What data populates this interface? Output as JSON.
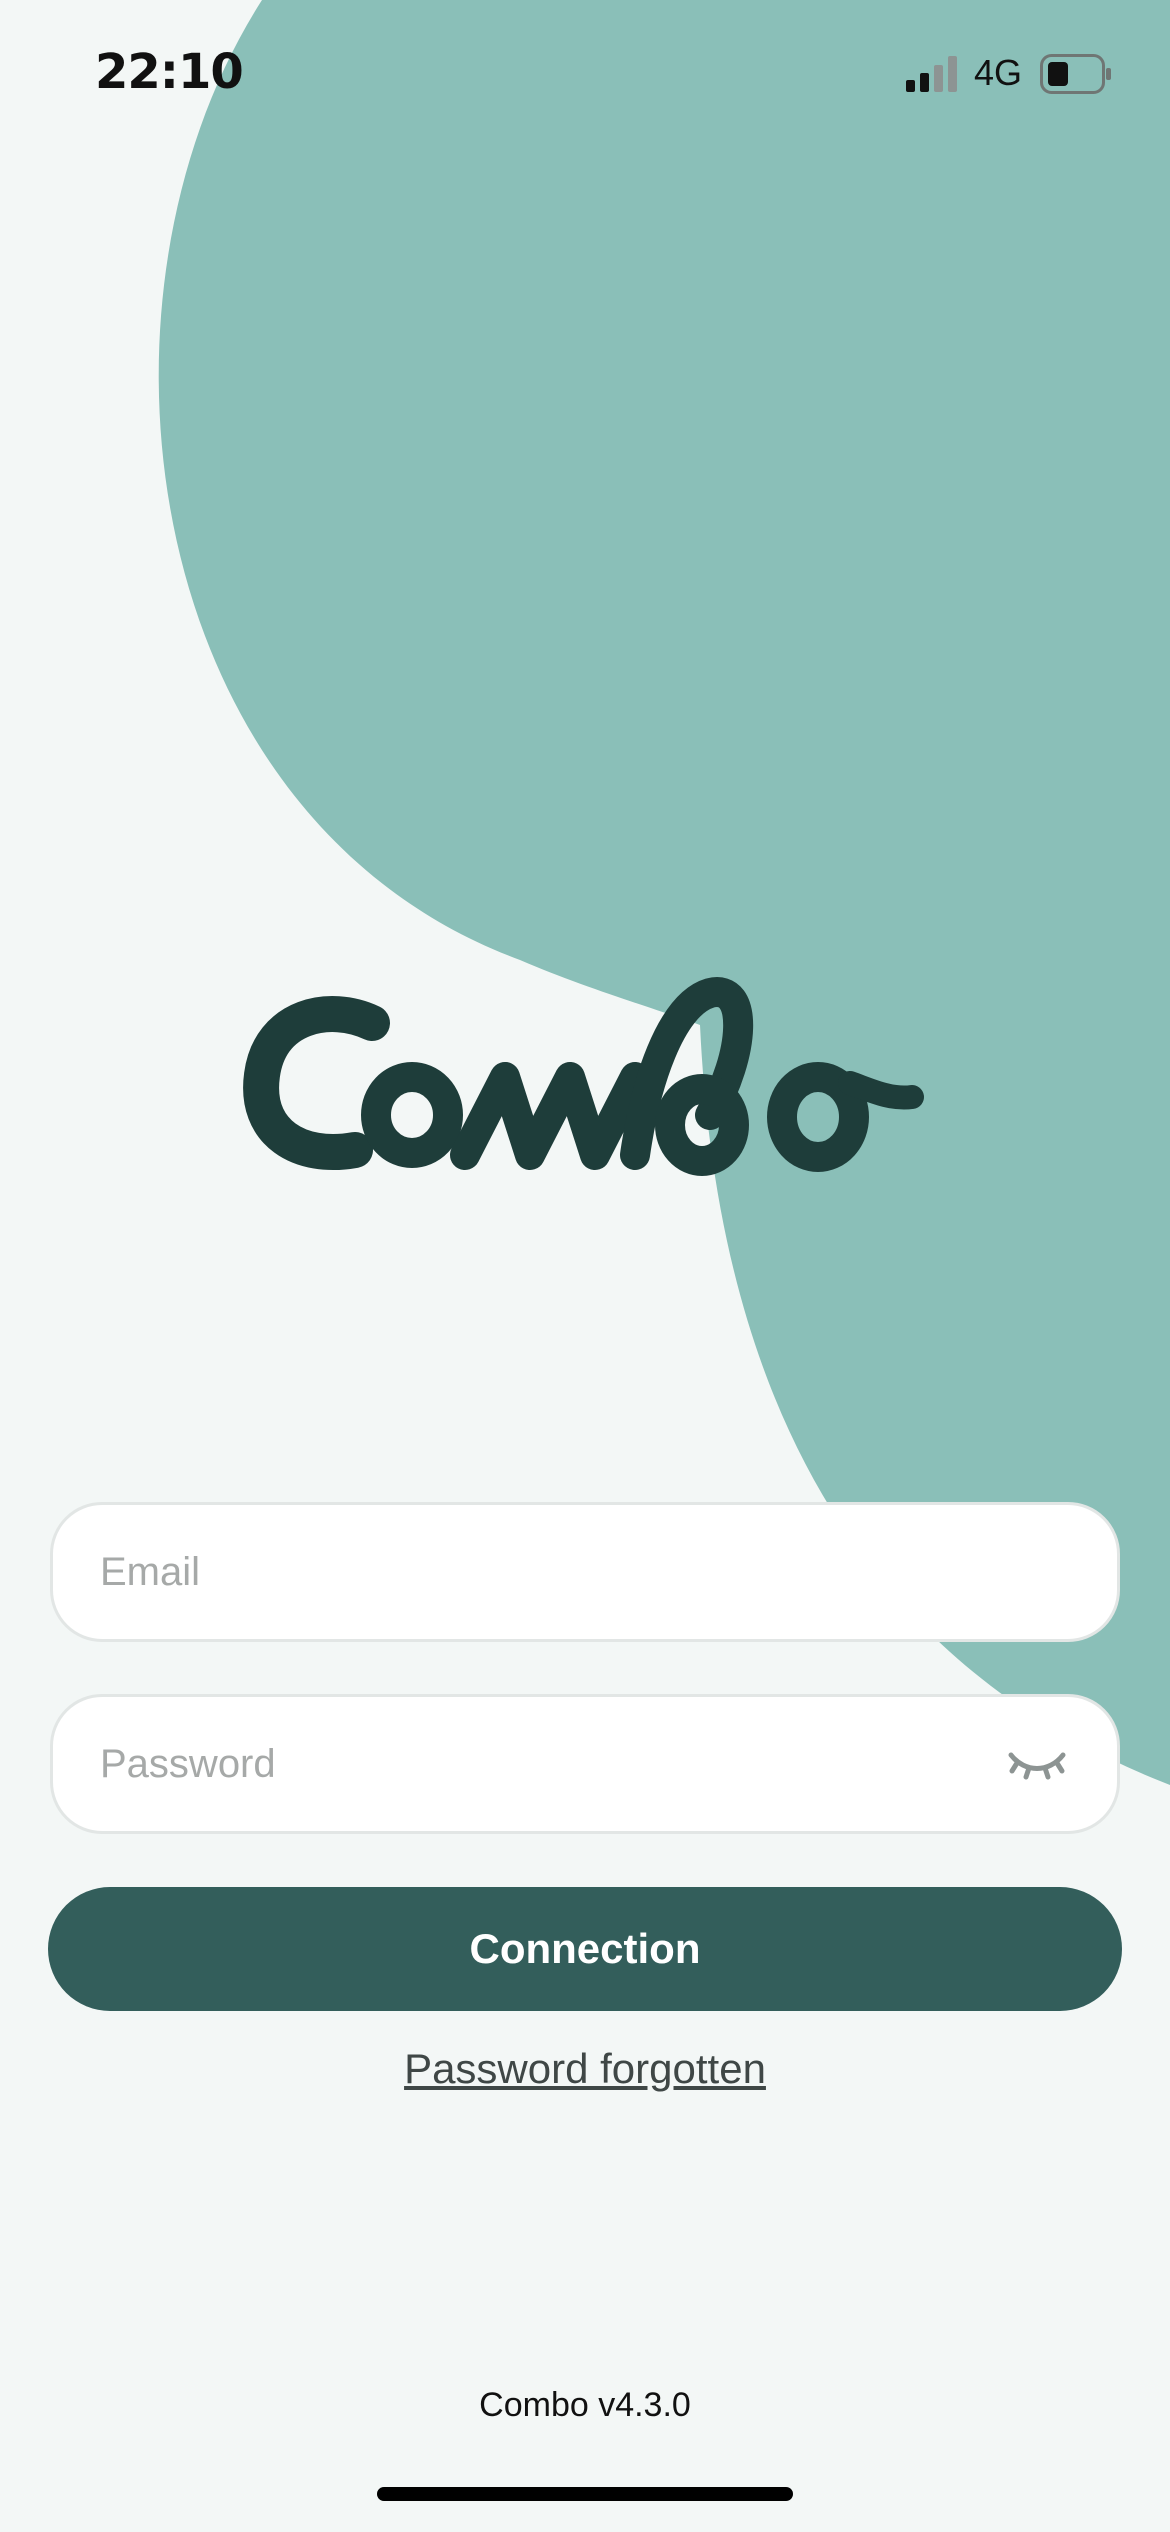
{
  "colors": {
    "background": "#f3f7f6",
    "accent_shape": "#8abfb8",
    "logo": "#1e3d3a",
    "button": "#335e5b"
  },
  "status_bar": {
    "time": "22:10",
    "network": "4G",
    "signal_icon": "cellular-signal-icon",
    "battery_icon": "battery-icon"
  },
  "brand": {
    "logo_text": "Combo"
  },
  "login_form": {
    "email_placeholder": "Email",
    "password_placeholder": "Password",
    "password_toggle_icon": "eye-closed-icon",
    "submit_label": "Connection",
    "forgot_label": "Password forgotten"
  },
  "footer": {
    "version": "Combo v4.3.0"
  }
}
